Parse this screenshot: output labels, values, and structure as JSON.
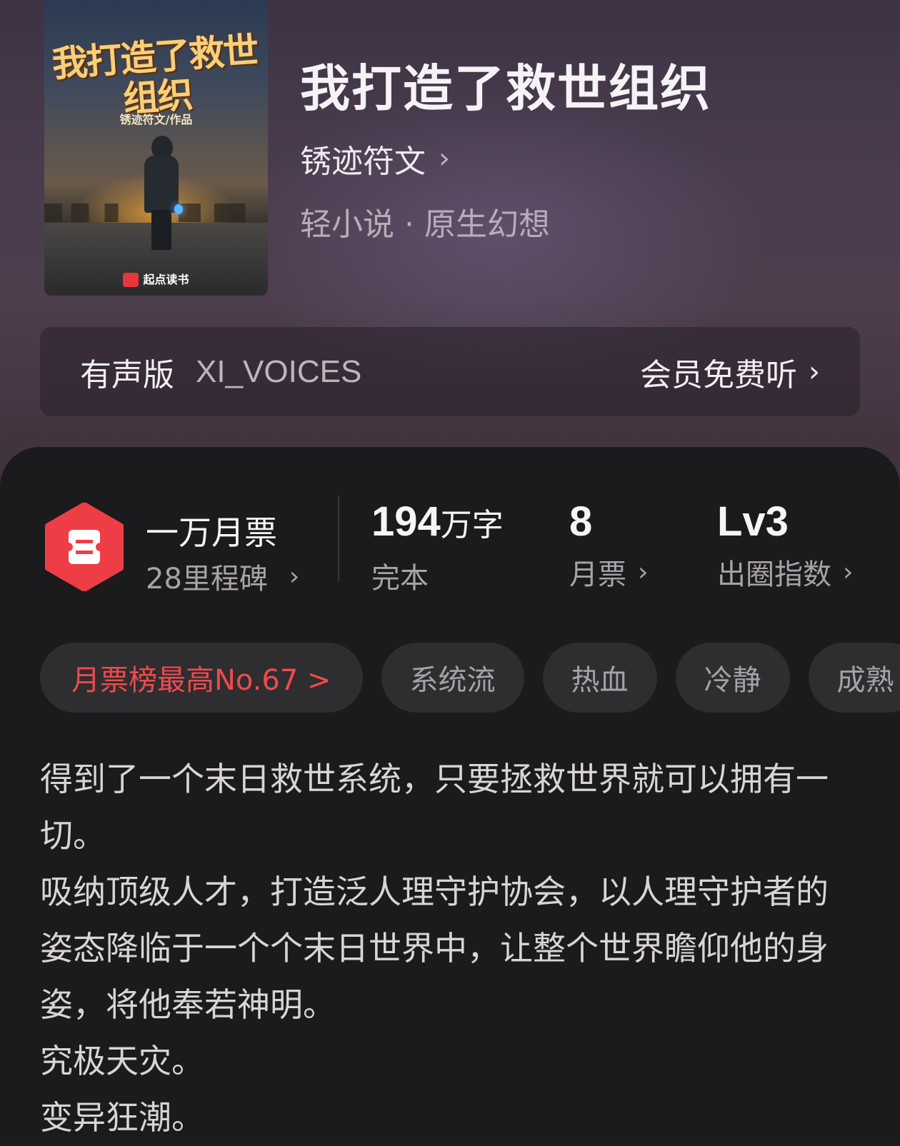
{
  "book": {
    "title": "我打造了救世组织",
    "author": "锈迹符文",
    "genre": "轻小说 · 原生幻想",
    "cover": {
      "title": "我打造了救世组织",
      "subtitle": "锈迹符文/作品",
      "publisher": "起点读书"
    }
  },
  "audio": {
    "label": "有声版",
    "narrator": "XI_VOICES",
    "cta": "会员免费听"
  },
  "stats": {
    "ticket": {
      "label": "一万月票",
      "sub": "28里程碑"
    },
    "words": {
      "number": "194",
      "unit": "万字",
      "label": "完本"
    },
    "monthly": {
      "number": "8",
      "label": "月票"
    },
    "index": {
      "number": "Lv3",
      "label": "出圈指数"
    }
  },
  "tags": [
    {
      "label": "月票榜最高No.67 >",
      "type": "rank"
    },
    {
      "label": "系统流"
    },
    {
      "label": "热血"
    },
    {
      "label": "冷静"
    },
    {
      "label": "成熟"
    }
  ],
  "synopsis": [
    "得到了一个末日救世系统，只要拯救世界就可以拥有一切。",
    "吸纳顶级人才，打造泛人理守护协会，以人理守护者的姿态降临于一个个末日世界中，让整个世界瞻仰他的身姿，将他奉若神明。",
    "究极天灾。",
    "变异狂潮。"
  ],
  "icons": {
    "ticket": "ticket-hexagon-icon",
    "chevron": "chevron-right-icon"
  },
  "colors": {
    "accent_red": "#f04a4c",
    "hex_red": "#ee3d45"
  }
}
